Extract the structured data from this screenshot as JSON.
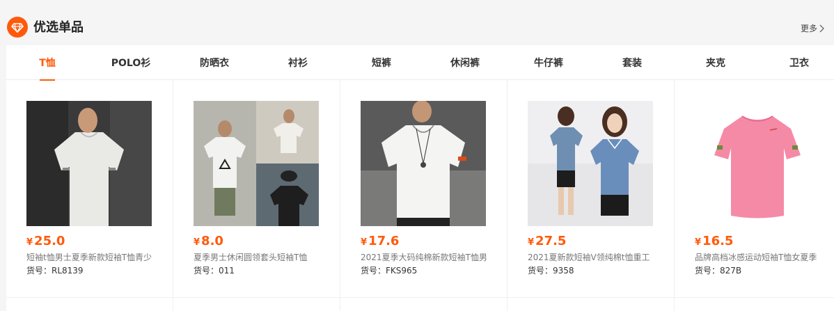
{
  "header": {
    "title": "优选单品",
    "more_label": "更多"
  },
  "tabs": [
    {
      "label": "T恤",
      "active": true
    },
    {
      "label": "POLO衫"
    },
    {
      "label": "防晒衣"
    },
    {
      "label": "衬衫"
    },
    {
      "label": "短裤"
    },
    {
      "label": "休闲裤"
    },
    {
      "label": "牛仔裤"
    },
    {
      "label": "套装"
    },
    {
      "label": "夹克"
    },
    {
      "label": "卫衣"
    }
  ],
  "currency_symbol": "¥",
  "products": [
    {
      "price": "25.0",
      "name": "短袖t恤男士夏季新款短袖T恤青少",
      "sku": "货号：RL8139"
    },
    {
      "price": "8.0",
      "name": "夏季男士休闲圆领套头短袖T恤",
      "sku": "货号：011"
    },
    {
      "price": "17.6",
      "name": "2021夏季大码纯棉新款短袖T恤男",
      "sku": "货号：FKS965"
    },
    {
      "price": "27.5",
      "name": "2021夏新款短袖V领纯棉t恤重工",
      "sku": "货号：9358"
    },
    {
      "price": "16.5",
      "name": "品牌高档冰感运动短袖T恤女夏季",
      "sku": "货号：827B"
    }
  ],
  "colors": {
    "accent": "#ff5a0b",
    "pink_tee": "#f58aa6"
  }
}
